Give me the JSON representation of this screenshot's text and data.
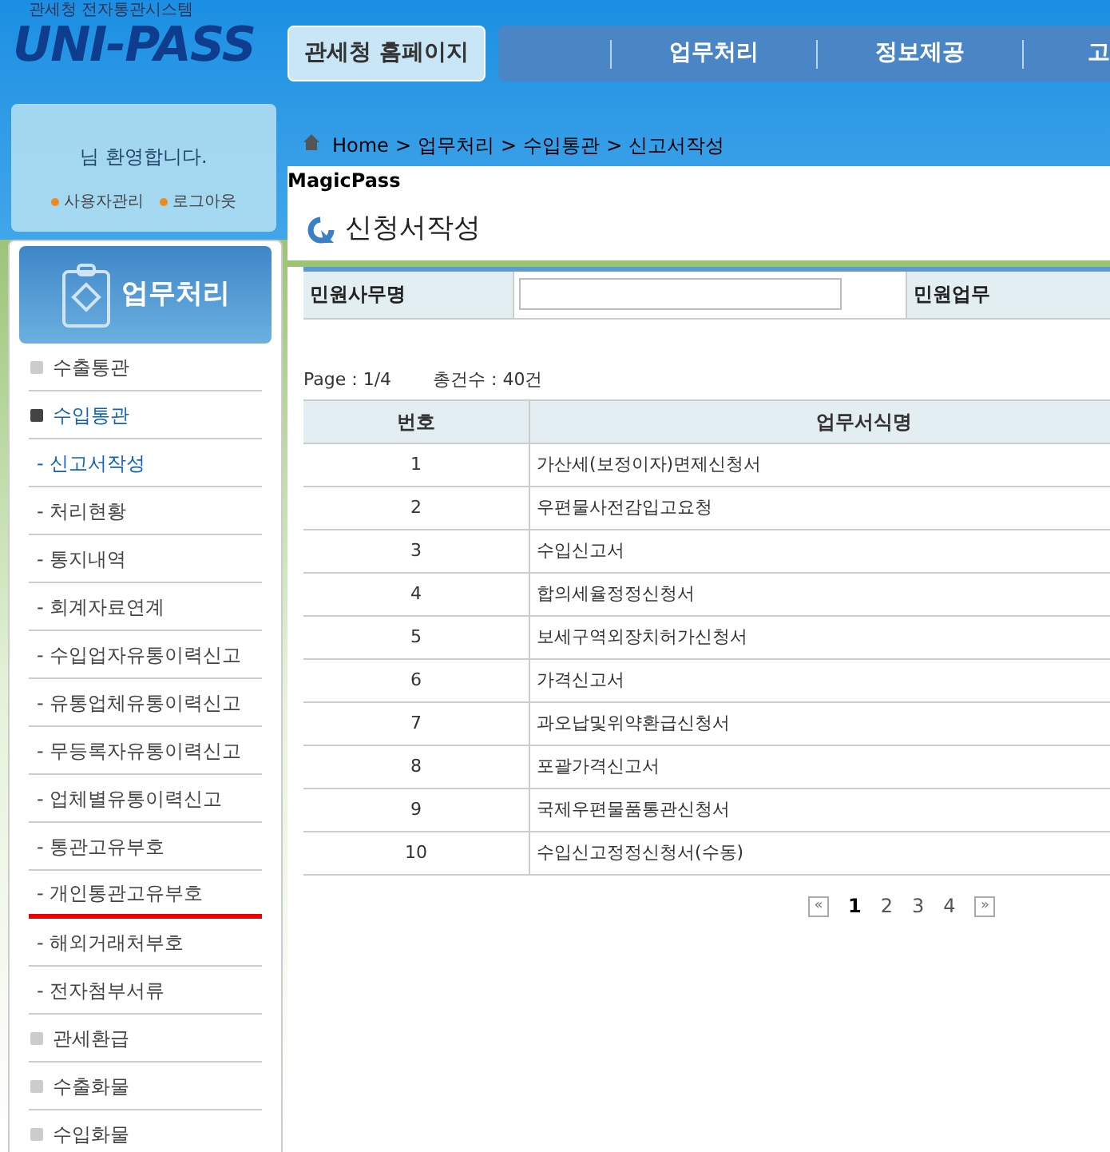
{
  "header": {
    "logo_caption": "관세청 전자통관시스템",
    "logo": "UNI-PASS",
    "home_link": "관세청 홈페이지",
    "nav": [
      "업무처리",
      "정보제공",
      "고"
    ]
  },
  "welcome": {
    "message": "님 환영합니다.",
    "links": [
      "사용자관리",
      "로그아웃"
    ]
  },
  "sidebar": {
    "title": "업무처리",
    "items": [
      {
        "kind": "section",
        "label": "수출통관",
        "selected": false,
        "underlined": false
      },
      {
        "kind": "section",
        "label": "수입통관",
        "selected": true,
        "underlined": false
      },
      {
        "kind": "sub",
        "label": "- 신고서작성",
        "selected": true,
        "underlined": false
      },
      {
        "kind": "sub",
        "label": "- 처리현황",
        "selected": false,
        "underlined": false
      },
      {
        "kind": "sub",
        "label": "- 통지내역",
        "selected": false,
        "underlined": false
      },
      {
        "kind": "sub",
        "label": "- 회계자료연계",
        "selected": false,
        "underlined": false
      },
      {
        "kind": "sub",
        "label": "- 수입업자유통이력신고",
        "selected": false,
        "underlined": false
      },
      {
        "kind": "sub",
        "label": "- 유통업체유통이력신고",
        "selected": false,
        "underlined": false
      },
      {
        "kind": "sub",
        "label": "- 무등록자유통이력신고",
        "selected": false,
        "underlined": false
      },
      {
        "kind": "sub",
        "label": "- 업체별유통이력신고",
        "selected": false,
        "underlined": false
      },
      {
        "kind": "sub",
        "label": "- 통관고유부호",
        "selected": false,
        "underlined": false
      },
      {
        "kind": "sub",
        "label": "- 개인통관고유부호",
        "selected": false,
        "underlined": true
      },
      {
        "kind": "sub",
        "label": "- 해외거래처부호",
        "selected": false,
        "underlined": false
      },
      {
        "kind": "sub",
        "label": "- 전자첨부서류",
        "selected": false,
        "underlined": false
      },
      {
        "kind": "section",
        "label": "관세환급",
        "selected": false,
        "underlined": false
      },
      {
        "kind": "section",
        "label": "수출화물",
        "selected": false,
        "underlined": false
      },
      {
        "kind": "section",
        "label": "수입화물",
        "selected": false,
        "underlined": false
      }
    ]
  },
  "breadcrumb": {
    "separator": ">",
    "items": [
      "Home",
      "업무처리",
      "수입통관",
      "신고서작성"
    ]
  },
  "app_name": "MagicPass",
  "page_title": "신청서작성",
  "search_form": {
    "fields": [
      {
        "label": "민원사무명",
        "kind": "input"
      },
      {
        "label": "민원업무"
      }
    ]
  },
  "page_info": {
    "page": "Page : 1/4",
    "total": "총건수 : 40건"
  },
  "table": {
    "columns": [
      "번호",
      "업무서식명"
    ],
    "rows": [
      [
        "1",
        "가산세(보정이자)면제신청서"
      ],
      [
        "2",
        "우편물사전감입고요청"
      ],
      [
        "3",
        "수입신고서"
      ],
      [
        "4",
        "합의세율정정신청서"
      ],
      [
        "5",
        "보세구역외장치허가신청서"
      ],
      [
        "6",
        "가격신고서"
      ],
      [
        "7",
        "과오납및위약환급신청서"
      ],
      [
        "8",
        "포괄가격신고서"
      ],
      [
        "9",
        "국제우편물품통관신청서"
      ],
      [
        "10",
        "수입신고정정신청서(수동)"
      ]
    ]
  },
  "pagination": {
    "first": "«",
    "pages": [
      {
        "label": "1",
        "selected": true
      },
      {
        "label": "2",
        "selected": false
      },
      {
        "label": "3",
        "selected": false
      },
      {
        "label": "4",
        "selected": false
      }
    ],
    "last": "»"
  }
}
